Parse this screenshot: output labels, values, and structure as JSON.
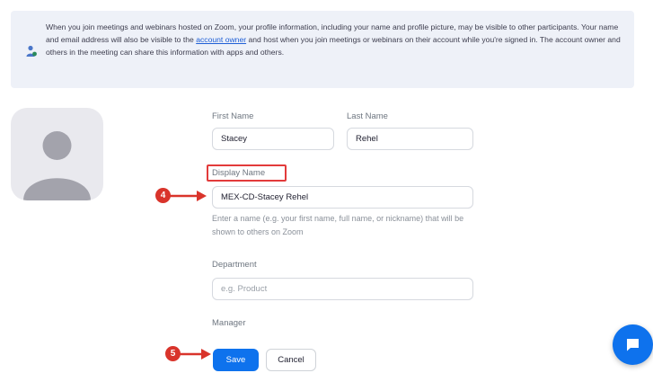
{
  "notice": {
    "text_before_link": "When you join meetings and webinars hosted on Zoom, your profile information, including your name and profile picture, may be visible to other participants. Your name and email address will also be visible to the ",
    "link_text": "account owner",
    "text_after_link": " and host when you join meetings or webinars on their account while you're signed in. The account owner and others in the meeting can share this information with apps and others.",
    "icon": "info-person-icon"
  },
  "avatar": {
    "icon": "default-avatar-icon"
  },
  "form": {
    "first_name": {
      "label": "First Name",
      "value": "Stacey"
    },
    "last_name": {
      "label": "Last Name",
      "value": "Rehel"
    },
    "display_name": {
      "label": "Display Name",
      "value": "MEX-CD-Stacey Rehel",
      "helper": "Enter a name (e.g. your first name, full name, or nickname) that will be shown to others on Zoom"
    },
    "department": {
      "label": "Department",
      "placeholder": "e.g. Product"
    },
    "manager": {
      "label": "Manager"
    }
  },
  "buttons": {
    "save": "Save",
    "cancel": "Cancel"
  },
  "annotations": {
    "step_display_name": "4",
    "step_save": "5",
    "color": "#d9342b"
  },
  "chat": {
    "icon": "chat-bubble-icon"
  },
  "colors": {
    "primary": "#0e72ed",
    "notice_bg": "#eef1f8",
    "highlight": "#e23b3b"
  }
}
